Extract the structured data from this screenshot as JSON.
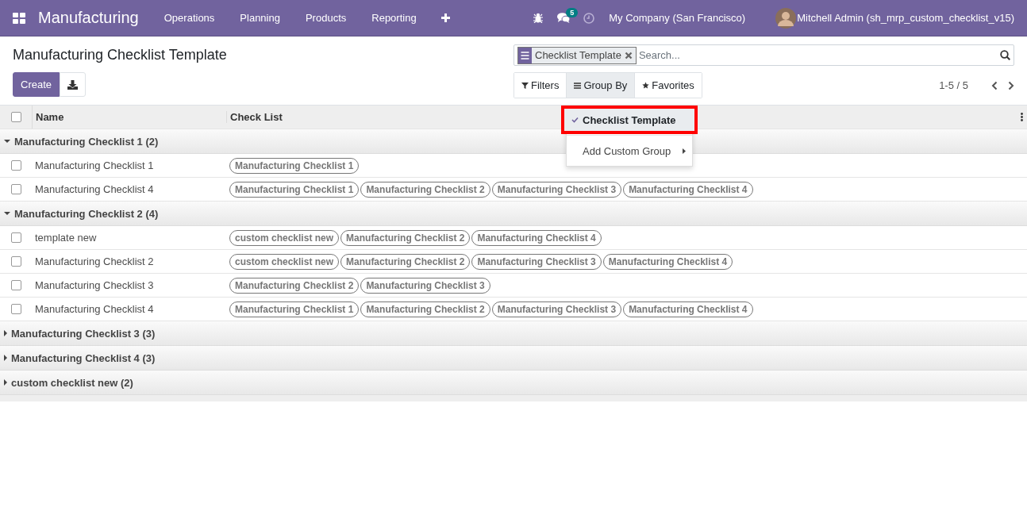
{
  "navbar": {
    "app_name": "Manufacturing",
    "menus": [
      "Operations",
      "Planning",
      "Products",
      "Reporting"
    ],
    "message_count": "5",
    "company": "My Company (San Francisco)",
    "user": "Mitchell Admin (sh_mrp_custom_checklist_v15)"
  },
  "control_panel": {
    "title": "Manufacturing Checklist Template",
    "create_button": "Create",
    "search": {
      "facets": [
        "Checklist Template"
      ],
      "placeholder": "Search..."
    },
    "filter_buttons": [
      {
        "kind": "filter",
        "label": "Filters",
        "selected": false
      },
      {
        "kind": "group",
        "label": "Group By",
        "selected": true
      },
      {
        "kind": "star",
        "label": "Favorites",
        "selected": false
      }
    ],
    "pager": "1-5 / 5"
  },
  "group_by_menu": [
    {
      "kind": "option",
      "label": "Checklist Template",
      "checked": true,
      "highlighted": true
    },
    {
      "kind": "submenu",
      "label": "Add Custom Group",
      "checked": false,
      "highlighted": false
    }
  ],
  "table": {
    "select_all_checked": false,
    "columns": [
      "Name",
      "Check List"
    ],
    "groups": [
      {
        "label": "Manufacturing Checklist 1 (2)",
        "expanded": true,
        "rows": [
          {
            "name": "Manufacturing Checklist 1",
            "checked": false,
            "tags": [
              "Manufacturing Checklist 1"
            ]
          },
          {
            "name": "Manufacturing Checklist 4",
            "checked": false,
            "tags": [
              "Manufacturing Checklist 1",
              "Manufacturing Checklist 2",
              "Manufacturing Checklist 3",
              "Manufacturing Checklist 4"
            ]
          }
        ]
      },
      {
        "label": "Manufacturing Checklist 2 (4)",
        "expanded": true,
        "rows": [
          {
            "name": "template new",
            "checked": false,
            "tags": [
              "custom checklist new",
              "Manufacturing Checklist 2",
              "Manufacturing Checklist 4"
            ]
          },
          {
            "name": "Manufacturing Checklist 2",
            "checked": false,
            "tags": [
              "custom checklist new",
              "Manufacturing Checklist 2",
              "Manufacturing Checklist 3",
              "Manufacturing Checklist 4"
            ]
          },
          {
            "name": "Manufacturing Checklist 3",
            "checked": false,
            "tags": [
              "Manufacturing Checklist 2",
              "Manufacturing Checklist 3"
            ]
          },
          {
            "name": "Manufacturing Checklist 4",
            "checked": false,
            "tags": [
              "Manufacturing Checklist 1",
              "Manufacturing Checklist 2",
              "Manufacturing Checklist 3",
              "Manufacturing Checklist 4"
            ]
          }
        ]
      },
      {
        "label": "Manufacturing Checklist 3 (3)",
        "expanded": false
      },
      {
        "label": "Manufacturing Checklist 4 (3)",
        "expanded": false
      },
      {
        "label": "custom checklist new (2)",
        "expanded": false
      }
    ]
  }
}
